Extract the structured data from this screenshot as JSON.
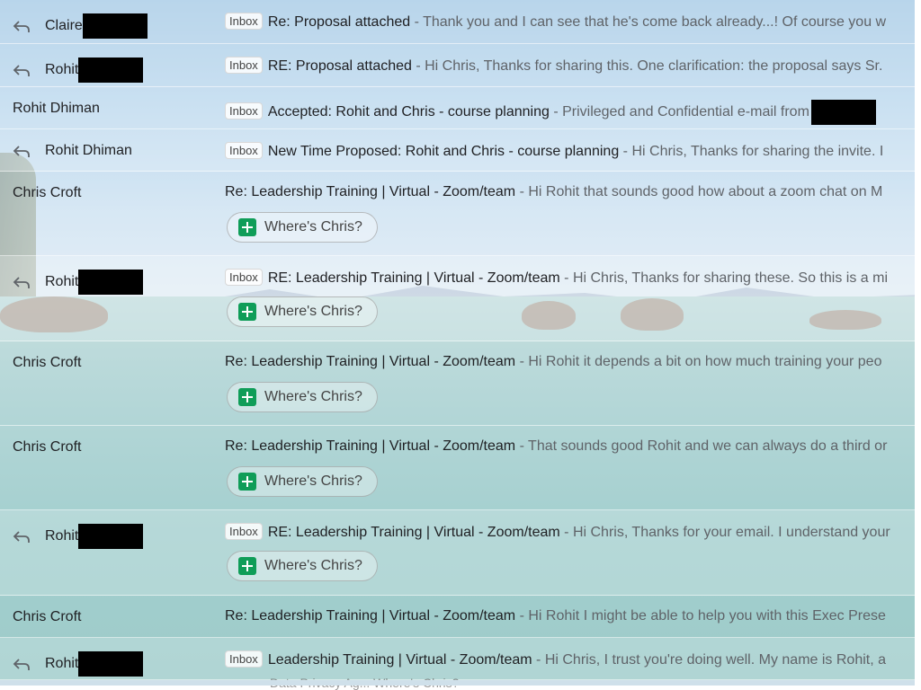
{
  "emails": [
    {
      "sender": "Claire",
      "replied": true,
      "redacted": true,
      "inbox": true,
      "badge": "Inbox",
      "subject": "Re: Proposal attached",
      "snippet": " - Thank you and I can see that he's come back already...! Of course you w",
      "chip": null
    },
    {
      "sender": "Rohit",
      "replied": true,
      "redacted": true,
      "inbox": true,
      "badge": "Inbox",
      "subject": "RE: Proposal attached",
      "snippet": " - Hi Chris, Thanks for sharing this. One clarification: the proposal says Sr.",
      "chip": null
    },
    {
      "sender": "Rohit Dhiman",
      "replied": false,
      "redacted": false,
      "inbox": true,
      "badge": "Inbox",
      "subject": "Accepted: Rohit and Chris - course planning",
      "snippet": " - Privileged and Confidential e-mail from",
      "chip": null
    },
    {
      "sender": "Rohit Dhiman",
      "replied": true,
      "redacted": false,
      "inbox": true,
      "badge": "Inbox",
      "subject": "New Time Proposed: Rohit and Chris - course planning",
      "snippet": " - Hi Chris, Thanks for sharing the invite. I",
      "chip": null
    },
    {
      "sender": "Chris Croft",
      "replied": false,
      "redacted": false,
      "inbox": false,
      "badge": "",
      "subject": "Re: Leadership Training | Virtual - Zoom/team",
      "snippet": " - Hi Rohit that sounds good how about a zoom chat on M",
      "chip": "Where's Chris?"
    },
    {
      "sender": "Rohit",
      "replied": true,
      "redacted": true,
      "inbox": true,
      "badge": "Inbox",
      "subject": "RE: Leadership Training | Virtual - Zoom/team",
      "snippet": " - Hi Chris, Thanks for sharing these. So this is a mi",
      "chip": "Where's Chris?"
    },
    {
      "sender": "Chris Croft",
      "replied": false,
      "redacted": false,
      "inbox": false,
      "badge": "",
      "subject": "Re: Leadership Training | Virtual - Zoom/team",
      "snippet": " - Hi Rohit it depends a bit on how much training your peo",
      "chip": "Where's Chris?"
    },
    {
      "sender": "Chris Croft",
      "replied": false,
      "redacted": false,
      "inbox": false,
      "badge": "",
      "subject": "Re: Leadership Training | Virtual - Zoom/team",
      "snippet": " - That sounds good Rohit and we can always do a third or",
      "chip": "Where's Chris?"
    },
    {
      "sender": "Rohit",
      "replied": true,
      "redacted": true,
      "inbox": true,
      "badge": "Inbox",
      "subject": "RE: Leadership Training | Virtual - Zoom/team",
      "snippet": " - Hi Chris, Thanks for your email. I understand your",
      "chip": "Where's Chris?"
    },
    {
      "sender": "Chris Croft",
      "replied": false,
      "redacted": false,
      "inbox": false,
      "badge": "",
      "subject": "Re: Leadership Training | Virtual - Zoom/team",
      "snippet": " - Hi Rohit I might be able to help you with this Exec Prese",
      "chip": null
    },
    {
      "sender": "Rohit",
      "replied": true,
      "redacted": true,
      "inbox": true,
      "badge": "Inbox",
      "subject": "Leadership Training | Virtual - Zoom/team",
      "snippet": " - Hi Chris, I trust you're doing well. My name is Rohit, a",
      "chip": null
    }
  ],
  "footer_clipped_text": "Data Privacy Ag...      Where's Chris?"
}
